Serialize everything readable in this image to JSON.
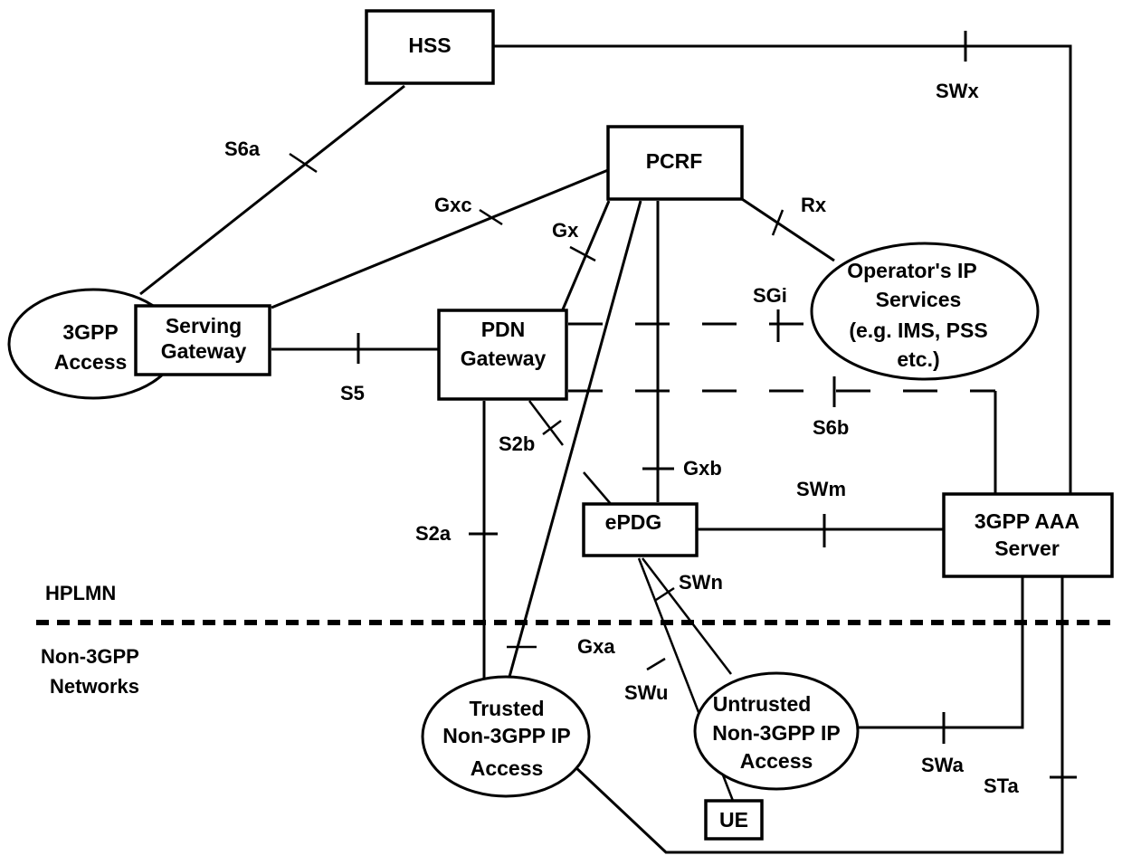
{
  "diagram": {
    "nodes": {
      "hss": "HSS",
      "pcrf": "PCRF",
      "serving_gateway": [
        "Serving",
        "Gateway"
      ],
      "pdn_gateway": [
        "PDN",
        "Gateway"
      ],
      "epdg": "ePDG",
      "aaa_server": [
        "3GPP AAA",
        "Server"
      ],
      "ue": "UE",
      "gpp_access": [
        "3GPP",
        "Access"
      ],
      "operator_ip": [
        "Operator's IP",
        "Services",
        "(e.g. IMS, PSS",
        "etc.)"
      ],
      "trusted": [
        "Trusted",
        "Non-3GPP IP",
        "Access"
      ],
      "untrusted": [
        "Untrusted",
        "Non-3GPP IP",
        "Access"
      ]
    },
    "interfaces": {
      "s6a": "S6a",
      "swx": "SWx",
      "gxc": "Gxc",
      "gx": "Gx",
      "rx": "Rx",
      "sgi": "SGi",
      "s5": "S5",
      "s6b": "S6b",
      "s2b": "S2b",
      "gxb": "Gxb",
      "swm": "SWm",
      "s2a": "S2a",
      "swn": "SWn",
      "gxa": "Gxa",
      "swu": "SWu",
      "swa": "SWa",
      "sta": "STa"
    },
    "regions": {
      "hplmn": "HPLMN",
      "non3gpp": [
        "Non-3GPP",
        "Networks"
      ]
    }
  }
}
